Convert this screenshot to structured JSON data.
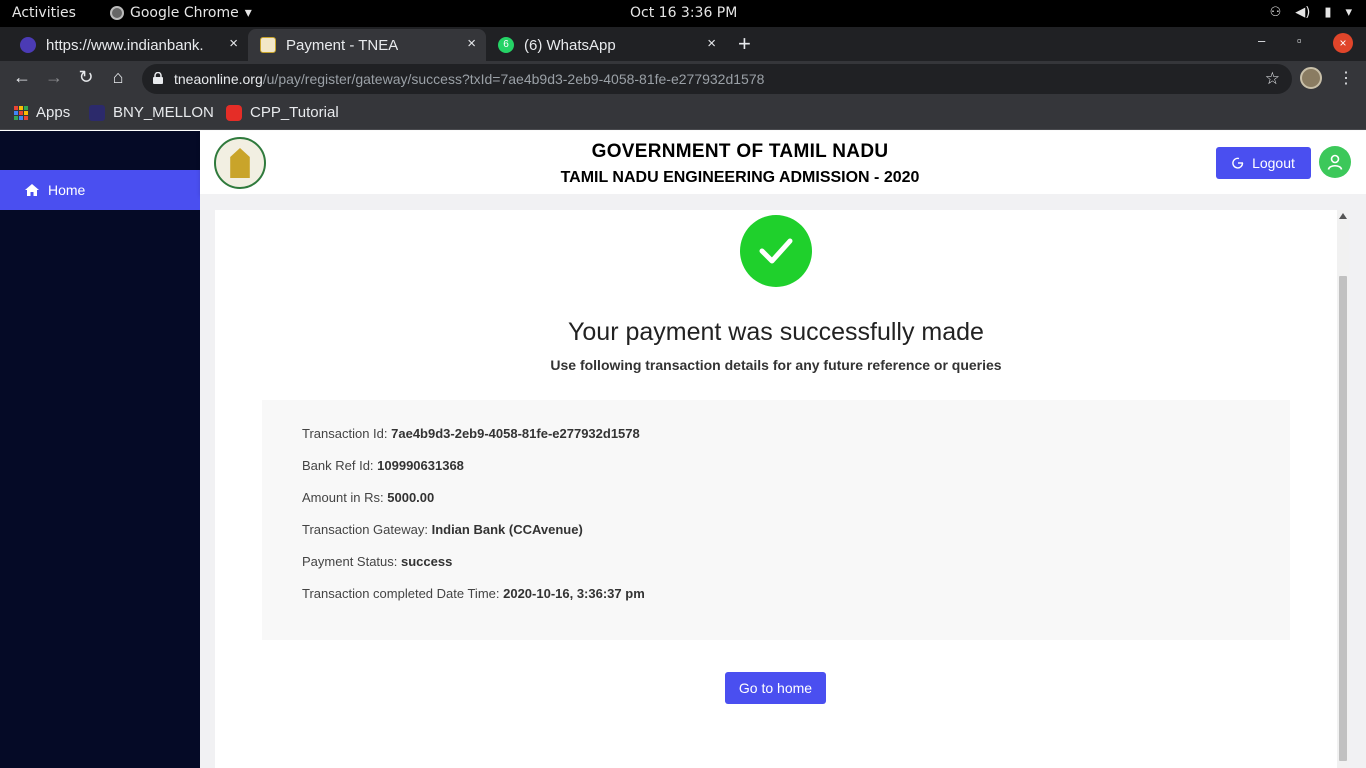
{
  "system": {
    "activities": "Activities",
    "app_name": "Google Chrome",
    "clock": "Oct 16   3:36 PM"
  },
  "tabs": [
    {
      "title": "https://www.indianbank.",
      "close": "×",
      "favicon": "indian-bank-favicon"
    },
    {
      "title": "Payment - TNEA",
      "close": "×",
      "favicon": "tnea-favicon"
    },
    {
      "title": "(6) WhatsApp",
      "close": "×",
      "favicon": "whatsapp-favicon",
      "badge": "6"
    }
  ],
  "window_controls": {
    "minimize": "–",
    "maximize": "▫",
    "close": "×"
  },
  "address_bar": {
    "host": "tneaonline.org",
    "path": "/u/pay/register/gateway/success?txId=7ae4b9d3-2eb9-4058-81fe-e277932d1578"
  },
  "bookmarks": [
    {
      "label": "Apps"
    },
    {
      "label": "BNY_MELLON"
    },
    {
      "label": "CPP_Tutorial"
    }
  ],
  "sidebar": {
    "items": [
      {
        "label": "Home",
        "icon": "home-icon"
      }
    ]
  },
  "header": {
    "title": "GOVERNMENT OF TAMIL NADU",
    "subtitle": "TAMIL NADU ENGINEERING ADMISSION - 2020",
    "logout_label": "Logout"
  },
  "payment": {
    "heading": "Your payment was successfully made",
    "subheading": "Use following transaction details for any future reference or queries",
    "details": [
      {
        "label": "Transaction Id: ",
        "value": "7ae4b9d3-2eb9-4058-81fe-e277932d1578"
      },
      {
        "label": "Bank Ref Id: ",
        "value": "109990631368"
      },
      {
        "label": "Amount in Rs: ",
        "value": "5000.00"
      },
      {
        "label": "Transaction Gateway: ",
        "value": "Indian Bank (CCAvenue)"
      },
      {
        "label": "Payment Status: ",
        "value": "success"
      },
      {
        "label": "Transaction completed Date Time: ",
        "value": "2020-10-16, 3:36:37 pm"
      }
    ],
    "home_button": "Go to home"
  },
  "colors": {
    "accent": "#4a4ff0",
    "sidebar_bg": "#050a26",
    "success": "#1fd02c"
  }
}
